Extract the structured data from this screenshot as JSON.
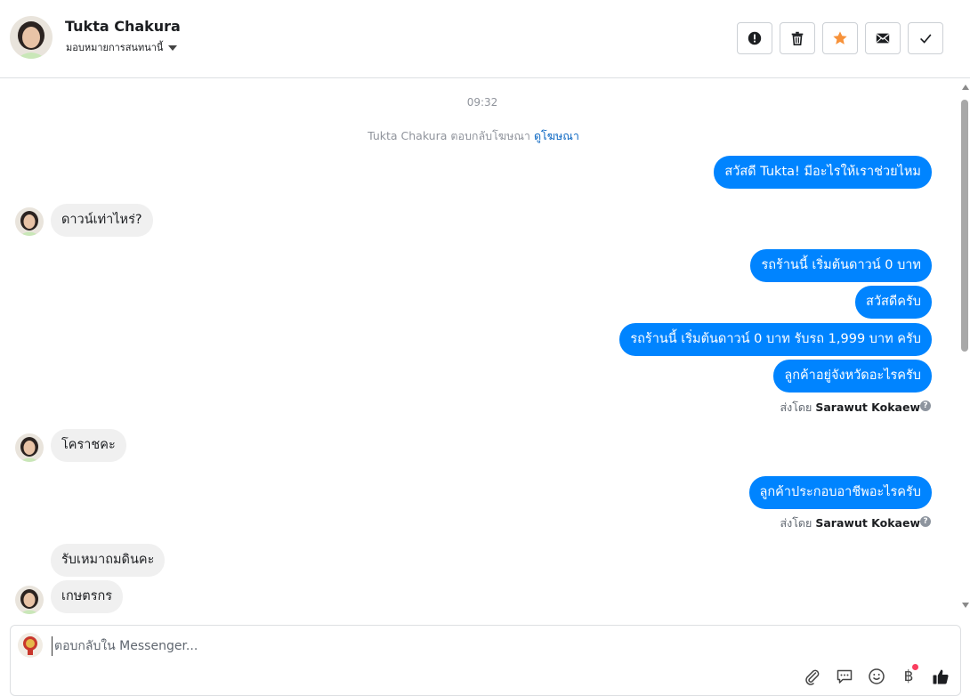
{
  "header": {
    "contact_name": "Tukta Chakura",
    "assign_label": "มอบหมายการสนทนานี้",
    "actions": [
      {
        "name": "mark-spam-button",
        "icon": "alert-circle-icon"
      },
      {
        "name": "delete-button",
        "icon": "trash-icon"
      },
      {
        "name": "star-button",
        "icon": "star-icon"
      },
      {
        "name": "mark-unread-button",
        "icon": "envelope-icon"
      },
      {
        "name": "mark-done-button",
        "icon": "check-icon"
      }
    ],
    "star_color": "#f7923a"
  },
  "conversation": {
    "timestamp": "09:32",
    "notice_text": "Tukta Chakura ตอบกลับโฆษณา",
    "notice_link": "ดูโฆษณา",
    "messages": {
      "out1": "สวัสดี Tukta! มีอะไรให้เราช่วยไหม",
      "in1": "ดาวน์เท่าไหร่?",
      "out2": "รถร้านนี้ เริ่มต้นดาวน์ 0 บาท",
      "out3": "สวัสดีครับ",
      "out4": "รถร้านนี้ เริ่มต้นดาวน์ 0 บาท รับรถ 1,999 บาท ครับ",
      "out5": "ลูกค้าอยู่จังหวัดอะไรครับ",
      "in2": "โคราชคะ",
      "out6": "ลูกค้าประกอบอาชีพอะไรครับ",
      "in3": "รับเหมาถมดินคะ",
      "in4": "เกษตรกร"
    },
    "sent_by_prefix": "ส่งโดย",
    "sent_by_name": "Sarawut Kokaew",
    "bubble_out_color": "#0084ff",
    "bubble_in_color": "#f0f0f0"
  },
  "composer": {
    "placeholder": "ตอบกลับใน Messenger...",
    "tools": [
      "paperclip-icon",
      "saved-reply-icon",
      "emoji-icon",
      "baht-payment-icon",
      "thumbs-up-icon"
    ],
    "baht_symbol": "฿"
  }
}
